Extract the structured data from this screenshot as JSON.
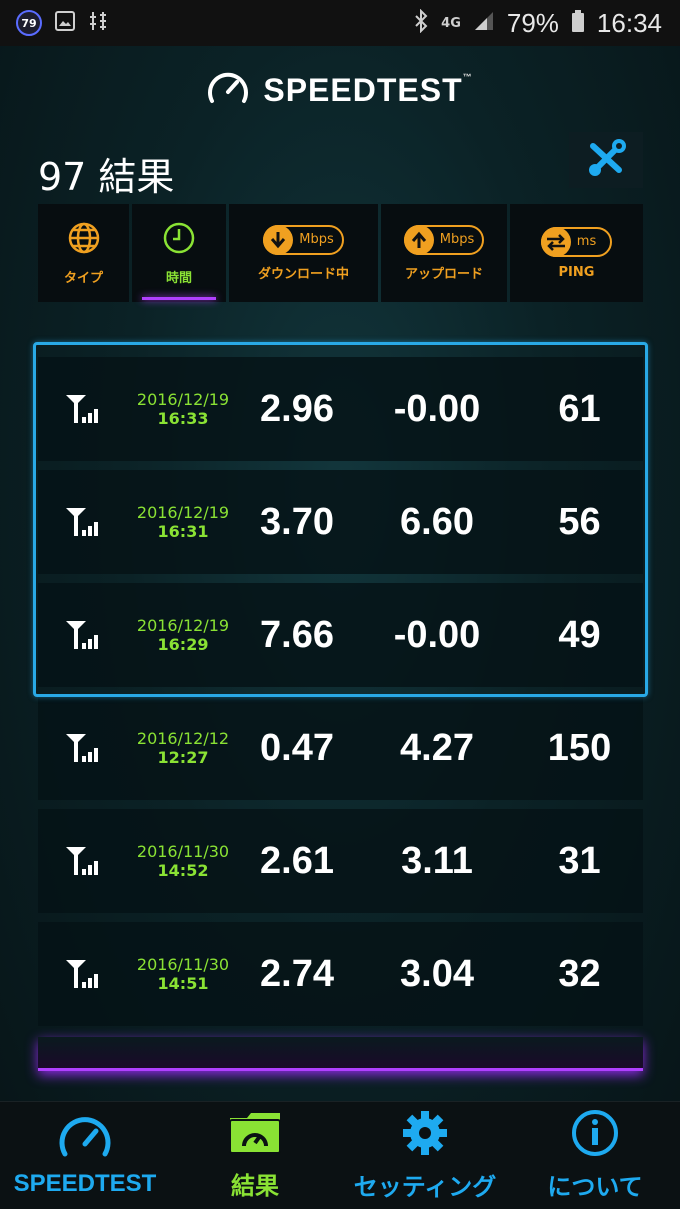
{
  "status_bar": {
    "notification_count": "79",
    "network": "4G",
    "battery": "79%",
    "time": "16:34"
  },
  "header": {
    "app_title": "SPEEDTEST",
    "trademark": "™",
    "results_title": "97 結果"
  },
  "sort_bar": {
    "type_label": "タイプ",
    "time_label": "時間",
    "download_label": "ダウンロード中",
    "download_unit": "Mbps",
    "upload_label": "アップロード",
    "upload_unit": "Mbps",
    "ping_label": "PING",
    "ping_unit": "ms"
  },
  "results": [
    {
      "date": "2016/12/19",
      "time": "16:33",
      "download": "2.96",
      "upload": "-0.00",
      "ping": "61"
    },
    {
      "date": "2016/12/19",
      "time": "16:31",
      "download": "3.70",
      "upload": "6.60",
      "ping": "56"
    },
    {
      "date": "2016/12/19",
      "time": "16:29",
      "download": "7.66",
      "upload": "-0.00",
      "ping": "49"
    },
    {
      "date": "2016/12/12",
      "time": "12:27",
      "download": "0.47",
      "upload": "4.27",
      "ping": "150"
    },
    {
      "date": "2016/11/30",
      "time": "14:52",
      "download": "2.61",
      "upload": "3.11",
      "ping": "31"
    },
    {
      "date": "2016/11/30",
      "time": "14:51",
      "download": "2.74",
      "upload": "3.04",
      "ping": "32"
    }
  ],
  "bottom_nav": {
    "speedtest": "SPEEDTEST",
    "results": "結果",
    "settings": "セッティング",
    "about": "について"
  },
  "colors": {
    "accent_orange": "#f0a020",
    "accent_green": "#8ae234",
    "accent_blue": "#1eaaf0",
    "highlight_purple": "#b040ff"
  }
}
